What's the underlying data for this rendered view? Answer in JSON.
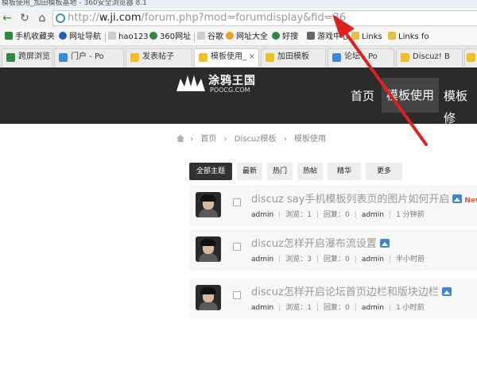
{
  "window": {
    "title": "模板使用_加田模板基地 - 360安全浏览器 8.1"
  },
  "addressbar": {
    "url_scheme": "http://",
    "url_host": "w.ji.com",
    "url_path": "/forum.php?mod=forumdisplay&fid=36"
  },
  "bookmarks": [
    {
      "label": "手机收藏夹",
      "color": "#2e8b3d"
    },
    {
      "label": "网址导航",
      "color": "#1f5fbf"
    },
    {
      "label": "hao123",
      "color": "#999999"
    },
    {
      "label": "360网址",
      "color": "#2e8b3d"
    },
    {
      "label": "谷歌",
      "color": "#999999"
    },
    {
      "label": "网址大全",
      "color": "#f0a020"
    },
    {
      "label": "好搜",
      "color": "#2e8b3d"
    },
    {
      "label": "游戏中心",
      "color": "#666666"
    },
    {
      "label": "Links",
      "color": "#e8c040"
    },
    {
      "label": "Links fo",
      "color": "#e8c040"
    }
  ],
  "tabs": [
    {
      "label": "跨屏浏览",
      "color": "#2e8b3d",
      "active": false
    },
    {
      "label": "门户 - Po",
      "color": "#3b8ad8",
      "active": false
    },
    {
      "label": "发表帖子",
      "color": "#f0c020",
      "active": false
    },
    {
      "label": "模板使用_",
      "color": "#f0c020",
      "active": true
    },
    {
      "label": "加田模板",
      "color": "#f0c020",
      "active": false
    },
    {
      "label": "论坛 - Po",
      "color": "#3b8ad8",
      "active": false
    },
    {
      "label": "Discuz! B",
      "color": "#f0c020",
      "active": false
    },
    {
      "label": "",
      "color": "#f0c020",
      "active": false
    }
  ],
  "site": {
    "logo_text": "涂鸦王国",
    "logo_sub": "POOCG.COM",
    "menu": [
      "首页",
      "模板使用",
      "模板修"
    ]
  },
  "breadcrumb": [
    "首页",
    "Discuz模板",
    "模板使用"
  ],
  "filters": [
    "全部主题",
    "最新",
    "热门",
    "热帖",
    "精华",
    "更多"
  ],
  "threads": [
    {
      "title": "discuz say手机模板列表页的图片如何开启",
      "has_image": true,
      "is_new": true,
      "new_label": "New",
      "author": "admin",
      "views": "浏览：1",
      "replies": "回复：0",
      "last_user": "admin",
      "time": "1 分钟前"
    },
    {
      "title": "discuz怎样开启瀑布流设置",
      "has_image": true,
      "is_new": false,
      "new_label": "",
      "author": "admin",
      "views": "浏览：3",
      "replies": "回复：0",
      "last_user": "admin",
      "time": "半小时前"
    },
    {
      "title": "discuz怎样开启论坛首页边栏和版块边栏",
      "has_image": true,
      "is_new": false,
      "new_label": "",
      "author": "admin",
      "views": "浏览：1",
      "replies": "回复：0",
      "last_user": "admin",
      "time": "1 小时前"
    }
  ],
  "annotation": {
    "arrow_color": "#e02020"
  }
}
